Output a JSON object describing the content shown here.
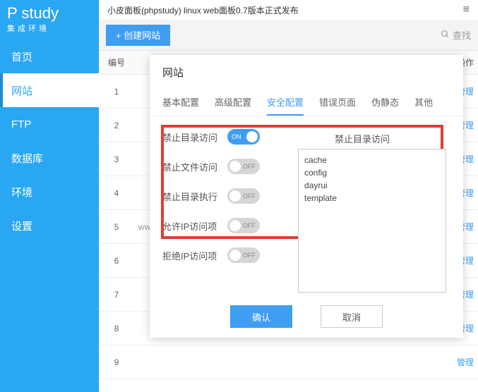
{
  "topbar": {
    "notice": "小皮面板(phpstudy) linux web面板0.7版本正式发布"
  },
  "brand": {
    "name": "study",
    "sub": "集成环境",
    "prefix": "P"
  },
  "nav": {
    "items": [
      "首页",
      "网站",
      "FTP",
      "数据库",
      "环境",
      "设置"
    ],
    "active": 1
  },
  "toolbar": {
    "create": "创建网站",
    "search": "查找"
  },
  "table": {
    "head": {
      "no": "编号",
      "ops": "操作"
    },
    "rows": [
      {
        "no": "1",
        "t": "",
        "op": "管理"
      },
      {
        "no": "2",
        "t": "",
        "op": "管理"
      },
      {
        "no": "3",
        "t": "",
        "op": "管理"
      },
      {
        "no": "4",
        "t": "",
        "op": "管理"
      },
      {
        "no": "5",
        "t": "ww",
        "op": "管理"
      },
      {
        "no": "6",
        "t": "",
        "op": "管理"
      },
      {
        "no": "7",
        "t": "",
        "op": "管理"
      },
      {
        "no": "8",
        "t": "",
        "op": "管理"
      },
      {
        "no": "9",
        "t": "",
        "op": "管理"
      }
    ]
  },
  "modal": {
    "title": "网站",
    "tabs": [
      "基本配置",
      "高级配置",
      "安全配置",
      "错误页面",
      "伪静态",
      "其他"
    ],
    "activeTab": 2,
    "fields": {
      "f1": "禁止目录访问",
      "f2": "禁止文件访问",
      "f3": "禁止目录执行",
      "f4": "允许IP访问项",
      "f5": "拒绝IP访问项",
      "rightHead": "禁止目录访问",
      "textarea": "cache\nconfig\ndayrui\ntemplate"
    },
    "on": "ON",
    "off": "OFF",
    "ok": "确认",
    "cancel": "取消"
  }
}
